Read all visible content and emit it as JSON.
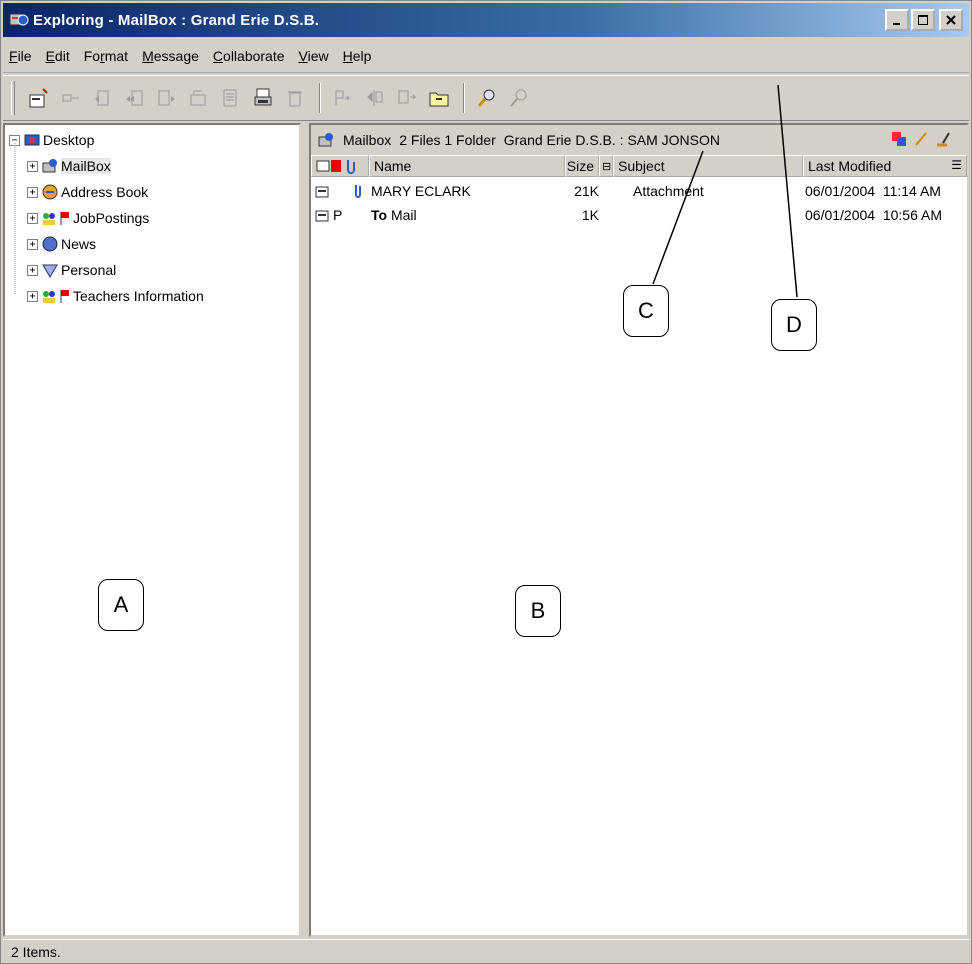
{
  "window": {
    "title": "Exploring - MailBox : Grand Erie D.S.B."
  },
  "menu": [
    "File",
    "Edit",
    "Format",
    "Message",
    "Collaborate",
    "View",
    "Help"
  ],
  "menu_underline": [
    "F",
    "E",
    "r",
    "M",
    "C",
    "V",
    "H"
  ],
  "tree": {
    "root": "Desktop",
    "items": [
      {
        "label": "MailBox",
        "icon": "mailbox-icon"
      },
      {
        "label": "Address Book",
        "icon": "address-book-icon"
      },
      {
        "label": "JobPostings",
        "icon": "shared-folder-flag-icon"
      },
      {
        "label": "News",
        "icon": "news-icon"
      },
      {
        "label": "Personal",
        "icon": "personal-folder-icon"
      },
      {
        "label": "Teachers Information",
        "icon": "shared-folder-flag-icon"
      }
    ]
  },
  "pathbar": {
    "folder": "Mailbox",
    "counts": "2 Files 1 Folder",
    "location": "Grand Erie D.S.B. : SAM JONSON"
  },
  "columns": {
    "name": "Name",
    "size": "Size",
    "subject": "Subject",
    "modified": "Last Modified"
  },
  "messages": [
    {
      "name": "MARY ECLARK",
      "size": "21K",
      "subject": "Attachment",
      "modified": "06/01/2004  11:14 AM",
      "attachment": true,
      "status": ""
    },
    {
      "name_prefix": "To",
      "name": "Mail",
      "size": "1K",
      "subject": "",
      "modified": "06/01/2004  10:56 AM",
      "attachment": false,
      "status": "P"
    }
  ],
  "status": "2 Items.",
  "annotations": {
    "a": "A",
    "b": "B",
    "c": "C",
    "d": "D"
  },
  "colors": {
    "title_start": "#0a246a",
    "title_end": "#a6caf0",
    "chrome": "#d4d0c8",
    "flag_red": "#e00000"
  }
}
